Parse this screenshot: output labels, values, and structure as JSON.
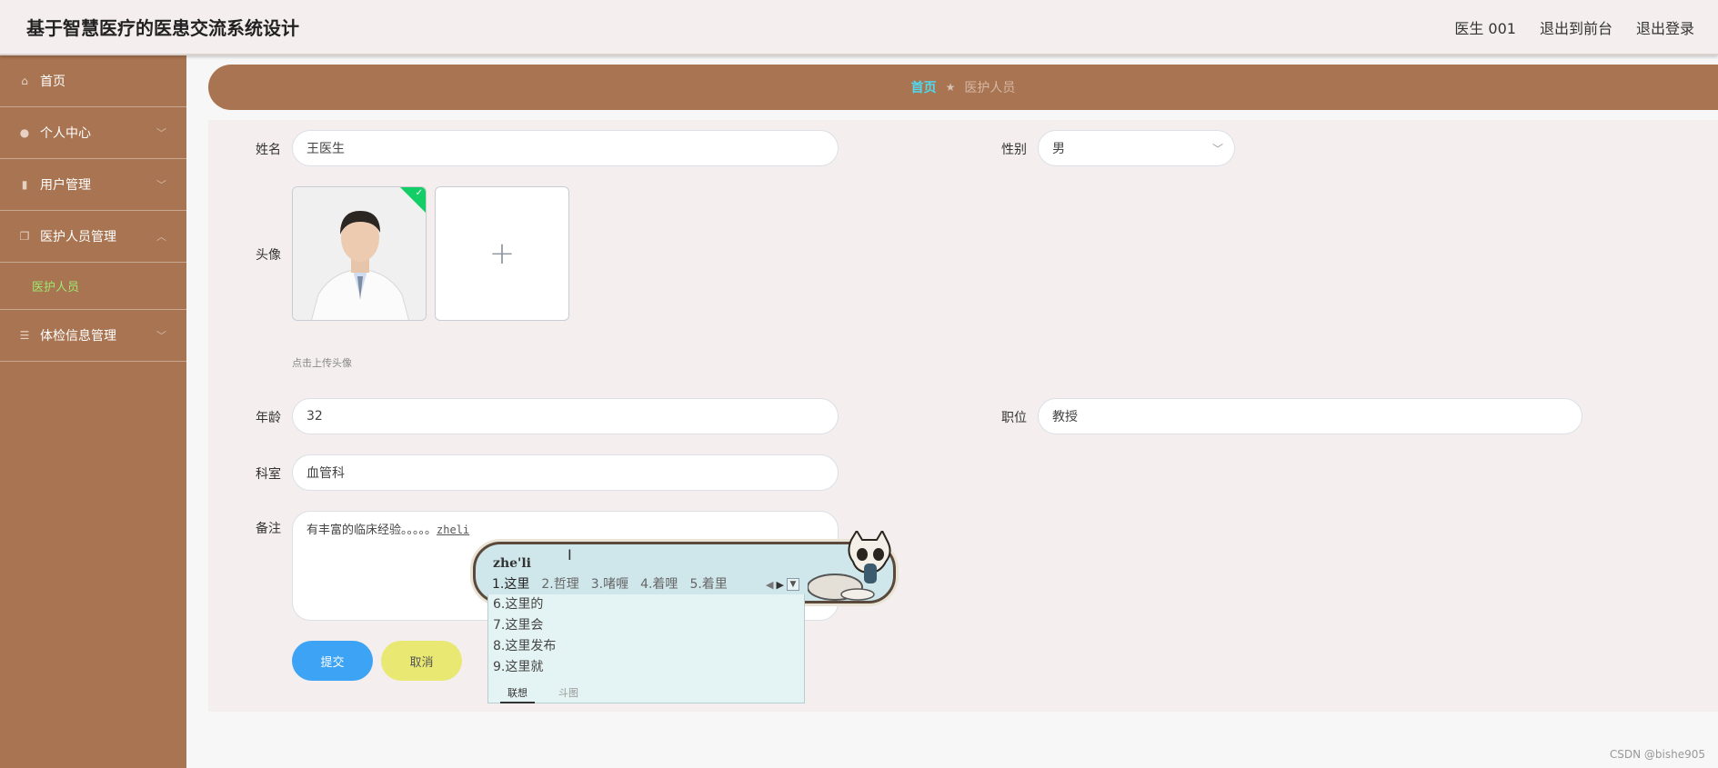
{
  "app": {
    "title": "基于智慧医疗的医患交流系统设计"
  },
  "header": {
    "user": "医生 001",
    "to_front": "退出到前台",
    "logout": "退出登录"
  },
  "sidebar": {
    "items": [
      {
        "label": "首页",
        "icon": "home-icon"
      },
      {
        "label": "个人中心",
        "icon": "user-icon"
      },
      {
        "label": "用户管理",
        "icon": "clipboard-icon"
      },
      {
        "label": "医护人员管理",
        "icon": "copy-icon"
      },
      {
        "label": "体检信息管理",
        "icon": "list-icon"
      }
    ],
    "sub_item": "医护人员"
  },
  "breadcrumb": {
    "home": "首页",
    "current": "医护人员"
  },
  "form": {
    "name": {
      "label": "姓名",
      "value": "王医生"
    },
    "gender": {
      "label": "性别",
      "value": "男"
    },
    "avatar": {
      "label": "头像",
      "hint": "点击上传头像"
    },
    "age": {
      "label": "年龄",
      "value": "32"
    },
    "position": {
      "label": "职位",
      "value": "教授"
    },
    "department": {
      "label": "科室",
      "value": "血管科"
    },
    "remark": {
      "label": "备注",
      "value": "有丰富的临床经验。。。。。",
      "composing": "zheli"
    },
    "submit": "提交",
    "cancel": "取消"
  },
  "ime": {
    "pinyin": "zhe'li",
    "row1": [
      "1.这里",
      "2.哲理",
      "3.啫喱",
      "4.着哩",
      "5.着里"
    ],
    "candidates": [
      "6.这里的",
      "7.这里会",
      "8.这里发布",
      "9.这里就"
    ],
    "tabs": [
      "联想",
      "斗图"
    ]
  },
  "watermark": "CSDN @bishe905",
  "colors": {
    "brown": "#a87451",
    "accent_cyan": "#4fd8ef",
    "sub_green": "#9fe870",
    "submit_blue": "#3da3f5",
    "cancel_yellow": "#e8e872"
  }
}
